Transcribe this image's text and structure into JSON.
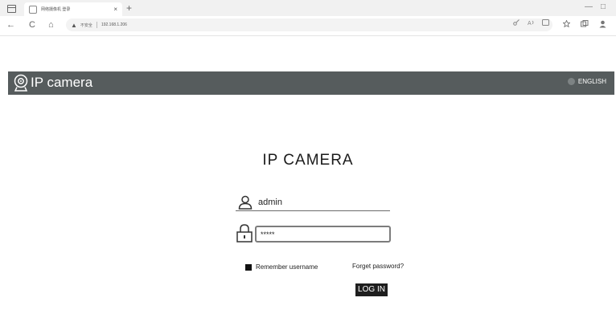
{
  "browser": {
    "tab_title": "网络摄像机 登录",
    "tab_close": "×",
    "new_tab": "+",
    "minimize": "—",
    "restore": "□",
    "nav_back": "←",
    "nav_reload": "C",
    "nav_home": "⌂",
    "security_warning": "▲",
    "security_label": "不安全",
    "url": "192.168.1.206"
  },
  "header": {
    "title": "IP camera",
    "language": "ENGLISH"
  },
  "login": {
    "title": "IP CAMERA",
    "username_value": "admin",
    "password_value": "*****",
    "remember_label": "Remember username",
    "forgot_label": "Forget password?",
    "login_button": "LOG IN"
  },
  "colors": {
    "header_bg": "#565c5d",
    "button_bg": "#1e1e1e"
  },
  "icons": {
    "logo": "camera-icon",
    "language": "globe-icon",
    "username": "user-icon",
    "password": "lock-icon"
  }
}
